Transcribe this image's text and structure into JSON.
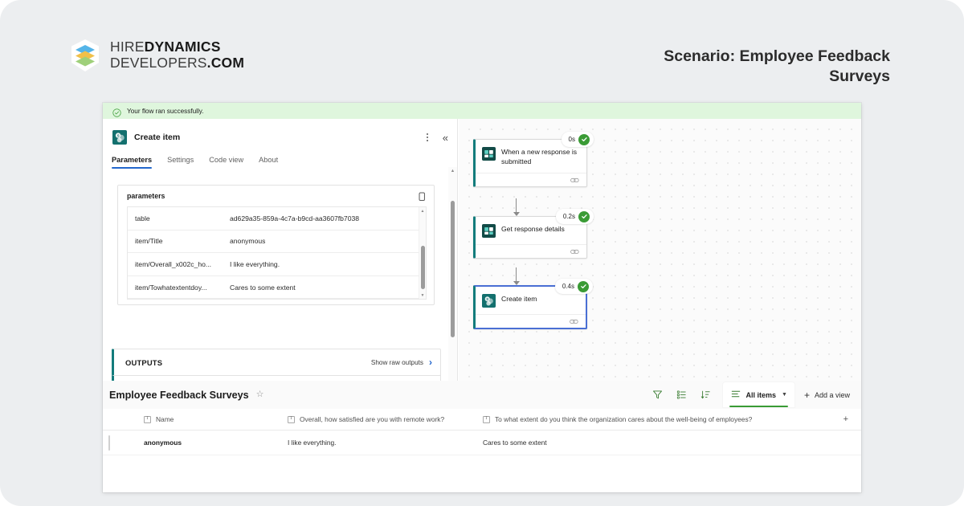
{
  "brand": {
    "line1_light": "HIRE",
    "line1_bold": "DYNAMICS",
    "line2_light": "DEVELOPERS",
    "line2_bold": ".COM",
    "logo_colors": {
      "top": "#54b4e8",
      "middle": "#f0c04a",
      "bottom": "#9fd07a",
      "shell": "#ffffff"
    }
  },
  "header": {
    "scenario_title": "Scenario: Employee Feedback Surveys"
  },
  "flow_run": {
    "banner_text": "Your flow ran successfully.",
    "banner_bg": "#dff6dd",
    "banner_icon": "check-circle-icon"
  },
  "action_pane": {
    "title": "Create item",
    "icon": "sharepoint-icon",
    "more_icon": "more-vertical-icon",
    "collapse_icon": "double-chevron-left-icon",
    "tabs": [
      {
        "label": "Parameters",
        "active": true
      },
      {
        "label": "Settings",
        "active": false
      },
      {
        "label": "Code view",
        "active": false
      },
      {
        "label": "About",
        "active": false
      }
    ],
    "parameters": {
      "section_label": "parameters",
      "copy_icon": "copy-icon",
      "rows": [
        {
          "key": "table",
          "value": "ad629a35-859a-4c7a-b9cd-aa3607fb7038"
        },
        {
          "key": "item/Title",
          "value": "anonymous"
        },
        {
          "key": "item/Overall_x002c_ho...",
          "value": "I like everything."
        },
        {
          "key": "item/Towhatextentdoy...",
          "value": "Cares to some extent"
        }
      ]
    },
    "outputs": {
      "label": "OUTPUTS",
      "link_label": "Show raw outputs",
      "link_chevron": "chevron-right-icon"
    }
  },
  "canvas": {
    "nodes": [
      {
        "label": "When a new response is submitted",
        "duration": "0s",
        "icon": "microsoft-forms-icon",
        "status": "succeeded",
        "selected": false,
        "link_icon": "link-icon"
      },
      {
        "label": "Get response details",
        "duration": "0.2s",
        "icon": "microsoft-forms-icon",
        "status": "succeeded",
        "selected": false,
        "link_icon": "link-icon"
      },
      {
        "label": "Create item",
        "duration": "0.4s",
        "icon": "sharepoint-icon",
        "status": "succeeded",
        "selected": true,
        "link_icon": "link-icon"
      }
    ],
    "accent_colors": {
      "node_rail": "#137c7c",
      "selected_border": "#4a6fd4",
      "success": "#3a9b35"
    }
  },
  "list": {
    "title": "Employee Feedback Surveys",
    "favorite_icon": "star-icon",
    "toolbar": {
      "filter_icon": "filter-icon",
      "list_icon": "list-format-icon",
      "sort_icon": "sort-icon",
      "view_icon": "view-lines-icon",
      "view_label": "All items",
      "view_chevron": "chevron-down-icon",
      "add_view_plus": "plus-icon",
      "add_view_label": "Add a view",
      "accent": "#3a9b35"
    },
    "columns": [
      {
        "label": "Name",
        "type_icon": "text-column-icon"
      },
      {
        "label": "Overall, how satisfied are you with remote work?",
        "type_icon": "text-column-icon"
      },
      {
        "label": "To what extent do you think the organization cares about the well-being of employees?",
        "type_icon": "text-column-icon"
      }
    ],
    "add_column_icon": "plus-icon",
    "rows": [
      {
        "name": "anonymous",
        "q1": "I like everything.",
        "q2": "Cares to some extent"
      }
    ]
  }
}
